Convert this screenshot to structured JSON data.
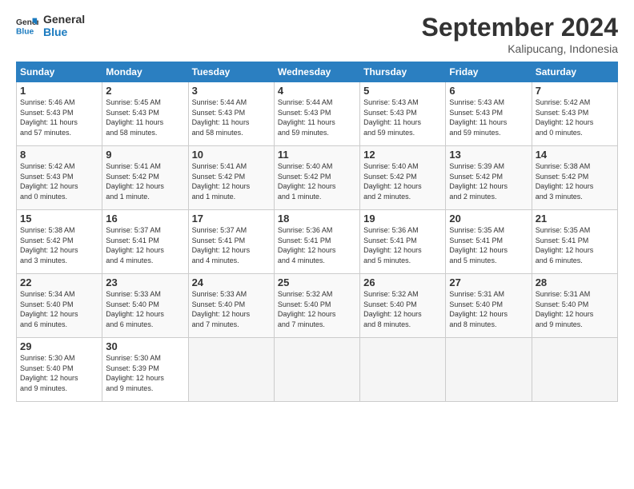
{
  "logo": {
    "line1": "General",
    "line2": "Blue"
  },
  "title": "September 2024",
  "subtitle": "Kalipucang, Indonesia",
  "days_of_week": [
    "Sunday",
    "Monday",
    "Tuesday",
    "Wednesday",
    "Thursday",
    "Friday",
    "Saturday"
  ],
  "weeks": [
    [
      {
        "day": "1",
        "info": "Sunrise: 5:46 AM\nSunset: 5:43 PM\nDaylight: 11 hours\nand 57 minutes."
      },
      {
        "day": "2",
        "info": "Sunrise: 5:45 AM\nSunset: 5:43 PM\nDaylight: 11 hours\nand 58 minutes."
      },
      {
        "day": "3",
        "info": "Sunrise: 5:44 AM\nSunset: 5:43 PM\nDaylight: 11 hours\nand 58 minutes."
      },
      {
        "day": "4",
        "info": "Sunrise: 5:44 AM\nSunset: 5:43 PM\nDaylight: 11 hours\nand 59 minutes."
      },
      {
        "day": "5",
        "info": "Sunrise: 5:43 AM\nSunset: 5:43 PM\nDaylight: 11 hours\nand 59 minutes."
      },
      {
        "day": "6",
        "info": "Sunrise: 5:43 AM\nSunset: 5:43 PM\nDaylight: 11 hours\nand 59 minutes."
      },
      {
        "day": "7",
        "info": "Sunrise: 5:42 AM\nSunset: 5:43 PM\nDaylight: 12 hours\nand 0 minutes."
      }
    ],
    [
      {
        "day": "8",
        "info": "Sunrise: 5:42 AM\nSunset: 5:43 PM\nDaylight: 12 hours\nand 0 minutes."
      },
      {
        "day": "9",
        "info": "Sunrise: 5:41 AM\nSunset: 5:42 PM\nDaylight: 12 hours\nand 1 minute."
      },
      {
        "day": "10",
        "info": "Sunrise: 5:41 AM\nSunset: 5:42 PM\nDaylight: 12 hours\nand 1 minute."
      },
      {
        "day": "11",
        "info": "Sunrise: 5:40 AM\nSunset: 5:42 PM\nDaylight: 12 hours\nand 1 minute."
      },
      {
        "day": "12",
        "info": "Sunrise: 5:40 AM\nSunset: 5:42 PM\nDaylight: 12 hours\nand 2 minutes."
      },
      {
        "day": "13",
        "info": "Sunrise: 5:39 AM\nSunset: 5:42 PM\nDaylight: 12 hours\nand 2 minutes."
      },
      {
        "day": "14",
        "info": "Sunrise: 5:38 AM\nSunset: 5:42 PM\nDaylight: 12 hours\nand 3 minutes."
      }
    ],
    [
      {
        "day": "15",
        "info": "Sunrise: 5:38 AM\nSunset: 5:42 PM\nDaylight: 12 hours\nand 3 minutes."
      },
      {
        "day": "16",
        "info": "Sunrise: 5:37 AM\nSunset: 5:41 PM\nDaylight: 12 hours\nand 4 minutes."
      },
      {
        "day": "17",
        "info": "Sunrise: 5:37 AM\nSunset: 5:41 PM\nDaylight: 12 hours\nand 4 minutes."
      },
      {
        "day": "18",
        "info": "Sunrise: 5:36 AM\nSunset: 5:41 PM\nDaylight: 12 hours\nand 4 minutes."
      },
      {
        "day": "19",
        "info": "Sunrise: 5:36 AM\nSunset: 5:41 PM\nDaylight: 12 hours\nand 5 minutes."
      },
      {
        "day": "20",
        "info": "Sunrise: 5:35 AM\nSunset: 5:41 PM\nDaylight: 12 hours\nand 5 minutes."
      },
      {
        "day": "21",
        "info": "Sunrise: 5:35 AM\nSunset: 5:41 PM\nDaylight: 12 hours\nand 6 minutes."
      }
    ],
    [
      {
        "day": "22",
        "info": "Sunrise: 5:34 AM\nSunset: 5:40 PM\nDaylight: 12 hours\nand 6 minutes."
      },
      {
        "day": "23",
        "info": "Sunrise: 5:33 AM\nSunset: 5:40 PM\nDaylight: 12 hours\nand 6 minutes."
      },
      {
        "day": "24",
        "info": "Sunrise: 5:33 AM\nSunset: 5:40 PM\nDaylight: 12 hours\nand 7 minutes."
      },
      {
        "day": "25",
        "info": "Sunrise: 5:32 AM\nSunset: 5:40 PM\nDaylight: 12 hours\nand 7 minutes."
      },
      {
        "day": "26",
        "info": "Sunrise: 5:32 AM\nSunset: 5:40 PM\nDaylight: 12 hours\nand 8 minutes."
      },
      {
        "day": "27",
        "info": "Sunrise: 5:31 AM\nSunset: 5:40 PM\nDaylight: 12 hours\nand 8 minutes."
      },
      {
        "day": "28",
        "info": "Sunrise: 5:31 AM\nSunset: 5:40 PM\nDaylight: 12 hours\nand 9 minutes."
      }
    ],
    [
      {
        "day": "29",
        "info": "Sunrise: 5:30 AM\nSunset: 5:40 PM\nDaylight: 12 hours\nand 9 minutes."
      },
      {
        "day": "30",
        "info": "Sunrise: 5:30 AM\nSunset: 5:39 PM\nDaylight: 12 hours\nand 9 minutes."
      },
      {
        "day": "",
        "info": ""
      },
      {
        "day": "",
        "info": ""
      },
      {
        "day": "",
        "info": ""
      },
      {
        "day": "",
        "info": ""
      },
      {
        "day": "",
        "info": ""
      }
    ]
  ]
}
